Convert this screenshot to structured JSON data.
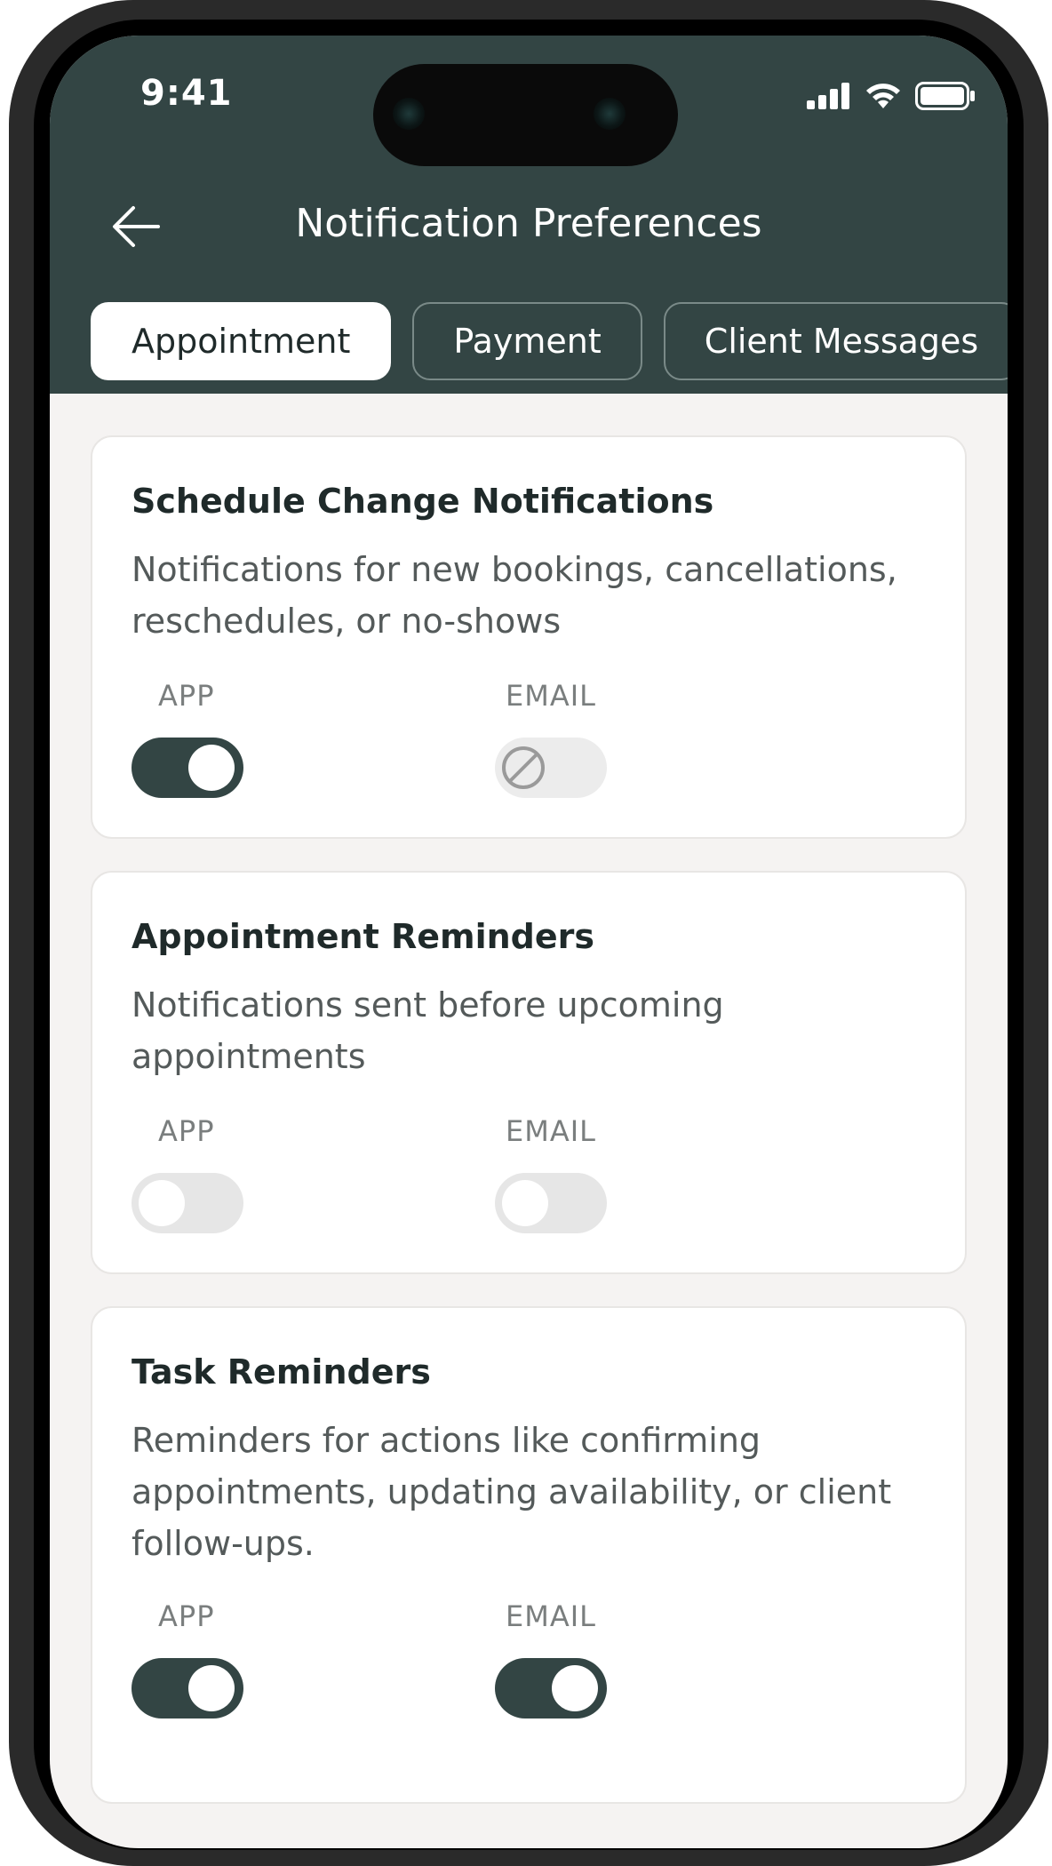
{
  "status_bar": {
    "time": "9:41"
  },
  "header": {
    "title": "Notification Preferences",
    "back_icon": "arrow-left-icon"
  },
  "tabs": [
    {
      "label": "Appointment",
      "active": true
    },
    {
      "label": "Payment",
      "active": false
    },
    {
      "label": "Client Messages",
      "active": false
    }
  ],
  "cards": [
    {
      "title": "Schedule Change Notifications",
      "description": "Notifications for new bookings, cancellations, reschedules, or no-shows",
      "app_label": "APP",
      "email_label": "EMAIL",
      "app_state": "on",
      "email_state": "disabled"
    },
    {
      "title": "Appointment Reminders",
      "description": "Notifications sent before upcoming appointments",
      "app_label": "APP",
      "email_label": "EMAIL",
      "app_state": "off",
      "email_state": "off"
    },
    {
      "title": "Task Reminders",
      "description": "Reminders for actions like confirming appointments, updating availability, or client follow-ups.",
      "app_label": "APP",
      "email_label": "EMAIL",
      "app_state": "on",
      "email_state": "on"
    }
  ],
  "colors": {
    "header_bg": "#334544",
    "toggle_on": "#334544",
    "toggle_off": "#e6e6e6",
    "screen_bg": "#f5f3f2"
  }
}
